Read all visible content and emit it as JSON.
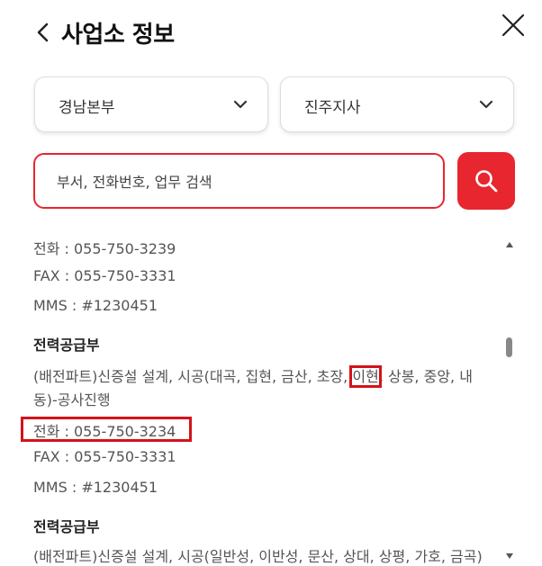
{
  "header": {
    "title": "사업소 정보"
  },
  "filters": {
    "region": "경남본부",
    "branch": "진주지사"
  },
  "search": {
    "placeholder": "부서, 전화번호, 업무 검색"
  },
  "results": {
    "top": {
      "phone": "전화 : 055-750-3239",
      "fax": "FAX : 055-750-3331",
      "mms": "MMS : #1230451"
    },
    "item1": {
      "dept": "전력공급부",
      "desc_a": "(배전파트)신증설 설계, 시공(대곡, 집현, 금산, 초장, ",
      "desc_highlight": "이현",
      "desc_b": ", 상봉, 중앙, 내",
      "desc_line2": "동)-공사진행",
      "phone": "전화 : 055-750-3234",
      "fax": "FAX : 055-750-3331",
      "mms": "MMS : #1230451"
    },
    "item2": {
      "dept": "전력공급부",
      "desc": "(배전파트)신증설 설계, 시공(일반성, 이반성, 문산, 상대, 상평, 가호, 금곡)"
    }
  },
  "colors": {
    "accent": "#e8262f",
    "highlight": "#d4121a"
  }
}
